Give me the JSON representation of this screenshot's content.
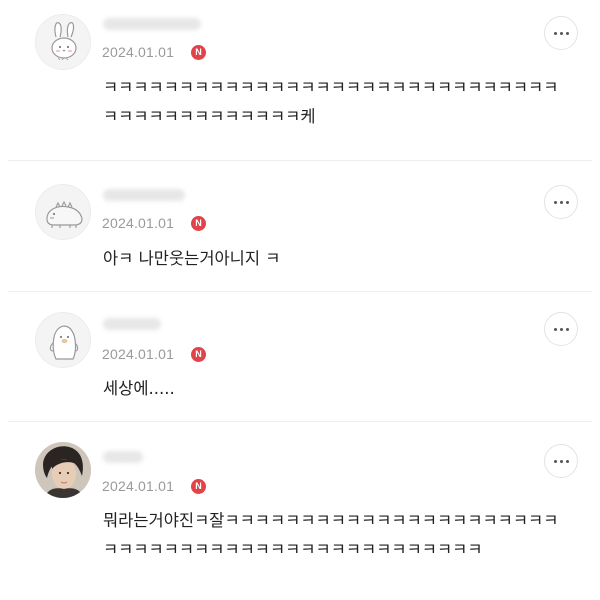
{
  "comments": [
    {
      "username": "",
      "date": "2024.01.01",
      "badge": "N",
      "avatar": "bunny-avatar-icon",
      "text": "ㅋㅋㅋㅋㅋㅋㅋㅋㅋㅋㅋㅋㅋㅋㅋㅋㅋㅋㅋㅋㅋㅋㅋㅋㅋㅋㅋㅋㅋㅋㅋㅋㅋㅋㅋㅋㅋㅋㅋㅋㅋㅋㅋ케"
    },
    {
      "username": "",
      "date": "2024.01.01",
      "badge": "N",
      "avatar": "dinosaur-avatar-icon",
      "text": "아ㅋ 나만웃는거아니지 ㅋ"
    },
    {
      "username": "",
      "date": "2024.01.01",
      "badge": "N",
      "avatar": "penguin-avatar-icon",
      "text": "세상에....."
    },
    {
      "username": "",
      "date": "2024.01.01",
      "badge": "N",
      "avatar": "profile-photo",
      "text": "뭐라는거야진ㅋ잘ㅋㅋㅋㅋㅋㅋㅋㅋㅋㅋㅋㅋㅋㅋㅋㅋㅋㅋㅋㅋㅋㅋㅋㅋㅋㅋㅋㅋㅋㅋㅋㅋㅋㅋㅋㅋㅋㅋㅋㅋㅋㅋㅋㅋㅋㅋㅋ"
    }
  ],
  "more_icon": "more-horizontal-icon"
}
